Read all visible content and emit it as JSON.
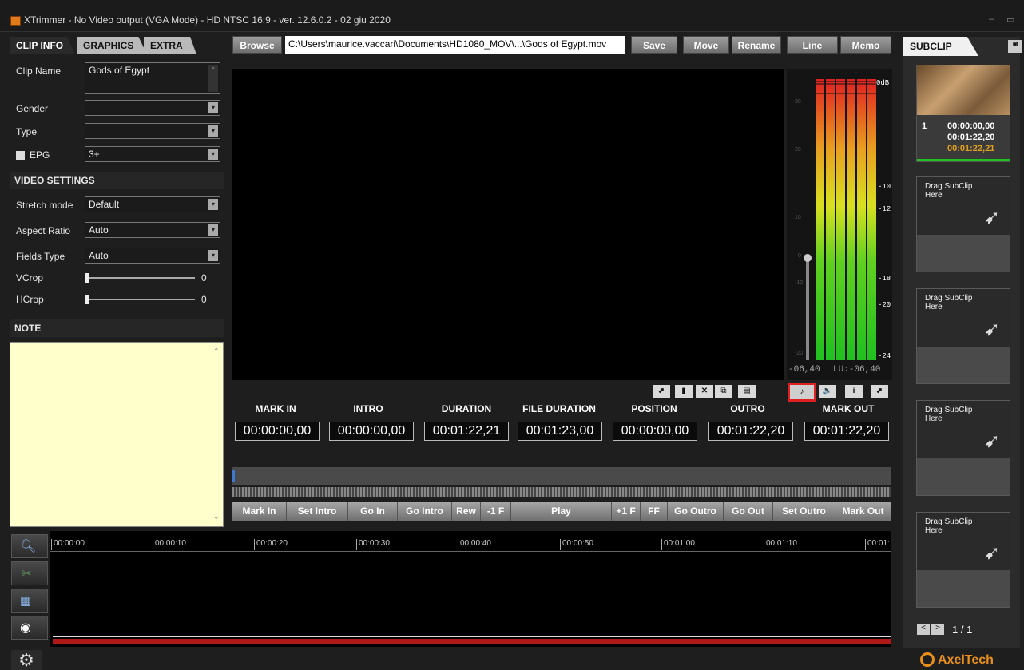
{
  "window": {
    "title": "XTrimmer - No Video output (VGA Mode) - HD NTSC 16:9 - ver. 12.6.0.2 - 02 giu 2020",
    "minimize": "–",
    "maximize": "▭"
  },
  "left_tabs": [
    "CLIP INFO",
    "GRAPHICS",
    "EXTRA"
  ],
  "clip_info": {
    "clip_name_label": "Clip Name",
    "clip_name_value": "Gods of Egypt",
    "gender_label": "Gender",
    "gender_value": "",
    "type_label": "Type",
    "type_value": "",
    "epg_label": "EPG",
    "epg_value": "3+"
  },
  "video_settings": {
    "header": "VIDEO SETTINGS",
    "stretch_label": "Stretch mode",
    "stretch_value": "Default",
    "aspect_label": "Aspect Ratio",
    "aspect_value": "Auto",
    "fields_label": "Fields Type",
    "fields_value": "Auto",
    "vcrop_label": "VCrop",
    "vcrop_value": "0",
    "hcrop_label": "HCrop",
    "hcrop_value": "0"
  },
  "note": {
    "header": "NOTE"
  },
  "toolbar": {
    "browse": "Browse",
    "path": "C:\\Users\\maurice.vaccari\\Documents\\HD1080_MOV\\...\\Gods of Egypt.mov",
    "save": "Save",
    "move": "Move",
    "rename": "Rename",
    "line": "Line",
    "memo": "Memo"
  },
  "vu": {
    "db0": "0dB",
    "m10": "-10",
    "m12": "-12",
    "m18": "-18",
    "m20": "-20",
    "m24": "-24",
    "readout_left": "-06,40",
    "readout_lu": "LU:-06,40",
    "scale": [
      "30",
      "20",
      "10",
      "0",
      "-10",
      "-20"
    ]
  },
  "timecodes": [
    {
      "label": "MARK IN",
      "value": "00:00:00,00"
    },
    {
      "label": "INTRO",
      "value": "00:00:00,00"
    },
    {
      "label": "DURATION",
      "value": "00:01:22,21"
    },
    {
      "label": "FILE DURATION",
      "value": "00:01:23,00"
    },
    {
      "label": "POSITION",
      "value": "00:00:00,00"
    },
    {
      "label": "OUTRO",
      "value": "00:01:22,20"
    },
    {
      "label": "MARK OUT",
      "value": "00:01:22,20"
    }
  ],
  "controls": [
    "Mark In",
    "Set Intro",
    "Go In",
    "Go Intro",
    "Rew",
    "-1 F",
    "Play",
    "+1 F",
    "FF",
    "Go Outro",
    "Go Out",
    "Set Outro",
    "Mark Out"
  ],
  "timeline_ticks": [
    "00:00:00",
    "00:00:10",
    "00:00:20",
    "00:00:30",
    "00:00:40",
    "00:00:50",
    "00:01:00",
    "00:01:10",
    "00:01:"
  ],
  "subclip": {
    "tab": "SUBCLIP",
    "item_index": "1",
    "item_tc1": "00:00:00,00",
    "item_tc2": "00:01:22,20",
    "item_tc3": "00:01:22,21",
    "drag_text": "Drag SubClip\nHere",
    "pager": "1 / 1"
  },
  "brand": "AxelTech",
  "colors": {
    "accent_orange": "#e0a020",
    "highlight_red": "#e02020",
    "timeline_red": "#b01818",
    "note_bg": "#ffffcc"
  }
}
